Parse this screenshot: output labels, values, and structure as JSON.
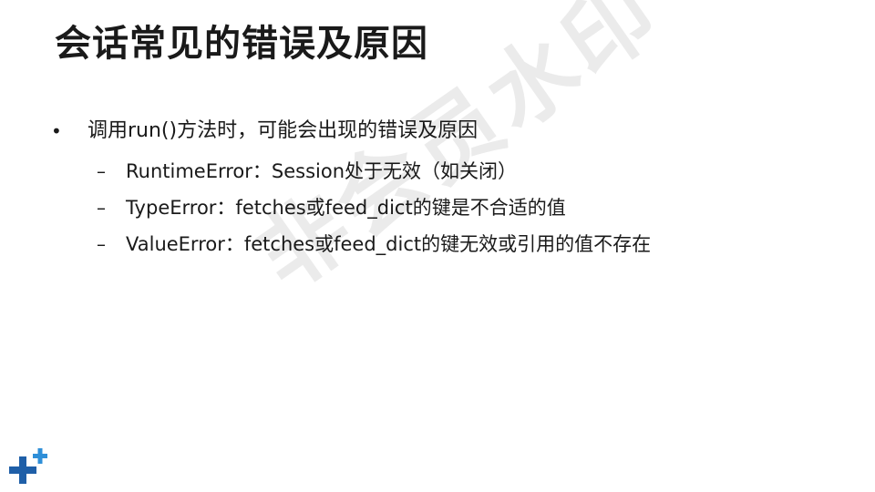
{
  "slide": {
    "title": "会话常见的错误及原因",
    "bullet": {
      "mark": "•",
      "text": "调用run()方法时，可能会出现的错误及原因"
    },
    "sub_items": [
      {
        "mark": "–",
        "text": "RuntimeError：Session处于无效（如关闭）"
      },
      {
        "mark": "–",
        "text": "TypeError：fetches或feed_dict的键是不合适的值"
      },
      {
        "mark": "–",
        "text": "ValueError：fetches或feed_dict的键无效或引用的值不存在"
      }
    ],
    "watermark": "非会员水印",
    "colors": {
      "text": "#1a1a1a",
      "logo_dark": "#1f5fa8",
      "logo_light": "#2f8fd8"
    },
    "logo_icon": "plus-cross-logo-icon"
  }
}
